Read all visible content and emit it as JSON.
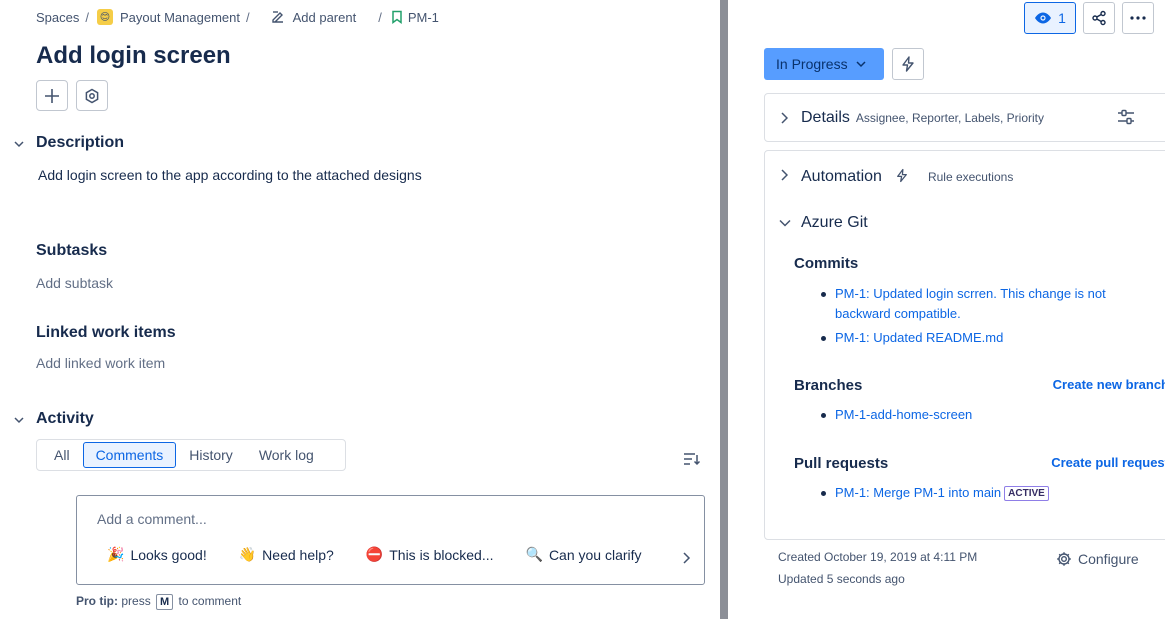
{
  "breadcrumb": {
    "spaces": "Spaces",
    "project": "Payout Management",
    "add_parent": "Add parent",
    "issue_key": "PM-1",
    "separator": "/"
  },
  "issue": {
    "title": "Add login screen",
    "description_heading": "Description",
    "description_text": "Add login screen to the app according to the attached designs",
    "subtasks_heading": "Subtasks",
    "subtasks_placeholder": "Add subtask",
    "linked_heading": "Linked work items",
    "linked_placeholder": "Add linked work item",
    "activity_heading": "Activity"
  },
  "activity": {
    "tabs": [
      "All",
      "Comments",
      "History",
      "Work log"
    ],
    "active_tab": "Comments",
    "comment_placeholder": "Add a comment...",
    "quick_replies": [
      {
        "icon": "🎉",
        "label": "Looks good!"
      },
      {
        "icon": "👋",
        "label": "Need help?"
      },
      {
        "icon": "⛔",
        "label": "This is blocked..."
      },
      {
        "icon": "🔍",
        "label": "Can you clarify"
      }
    ],
    "protip_label": "Pro tip:",
    "protip_pre": "press",
    "protip_key": "M",
    "protip_post": "to comment"
  },
  "toolbar": {
    "watch_count": "1"
  },
  "status": {
    "label": "In Progress"
  },
  "details": {
    "heading": "Details",
    "sub": "Assignee, Reporter, Labels, Priority"
  },
  "automation": {
    "heading": "Automation",
    "sub": "Rule executions"
  },
  "azure_git": {
    "heading": "Azure Git",
    "commits_heading": "Commits",
    "commits": [
      "PM-1: Updated login scrren. This change is not backward compatible.",
      "PM-1: Updated README.md"
    ],
    "branches_heading": "Branches",
    "create_branch": "Create new branch",
    "branches": [
      "PM-1-add-home-screen"
    ],
    "pr_heading": "Pull requests",
    "create_pr": "Create pull request",
    "pull_requests": [
      {
        "title": "PM-1: Merge PM-1 into main",
        "state": "ACTIVE"
      }
    ]
  },
  "footer": {
    "created": "Created October 19, 2019 at 4:11 PM",
    "updated": "Updated 5 seconds ago",
    "configure": "Configure"
  },
  "colors": {
    "accent": "#0c66e4",
    "status_bg": "#579dff",
    "divider": "#8c8f97"
  }
}
